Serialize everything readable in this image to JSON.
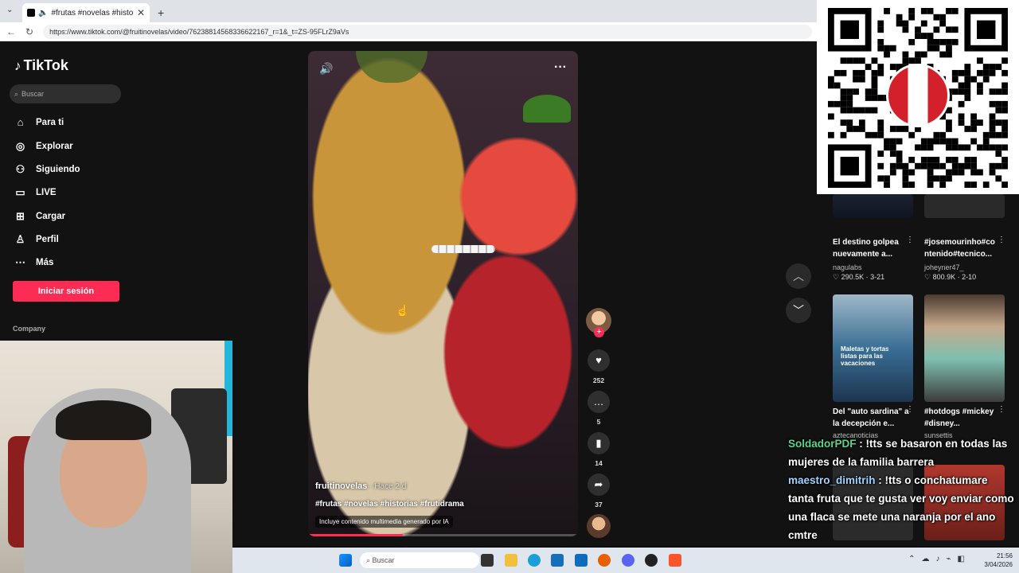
{
  "browser": {
    "tab_title": "#frutas #novelas #historias #",
    "tab_close": "✕",
    "new_tab": "+",
    "url": "https://www.tiktok.com/@fruitinovelas/video/76238814568336622167_r=1&_t=ZS-95FLrZ9aVs"
  },
  "sidebar": {
    "logo": "TikTok",
    "search_placeholder": "Buscar",
    "items": [
      {
        "label": "Para ti",
        "icon": "home-icon"
      },
      {
        "label": "Explorar",
        "icon": "compass-icon"
      },
      {
        "label": "Siguiendo",
        "icon": "following-icon"
      },
      {
        "label": "LIVE",
        "icon": "live-icon"
      },
      {
        "label": "Cargar",
        "icon": "upload-icon"
      },
      {
        "label": "Perfil",
        "icon": "profile-icon"
      },
      {
        "label": "Más",
        "icon": "more-dots-icon"
      }
    ],
    "login_label": "Iniciar sesión",
    "company_label": "Company"
  },
  "video": {
    "author": "fruitinovelas",
    "time": " · Hace 2 d",
    "caption": "#frutas #novelas #historias #frutidrama",
    "ai_badge": "Incluye contenido multimedia generado por IA",
    "progress": 0.35
  },
  "actions": {
    "likes": "252",
    "comments": "5",
    "saves": "14",
    "shares": "37"
  },
  "related": [
    {
      "title": "El destino golpea nuevamente a...",
      "author": "nagulabs",
      "stats": "♡ 290.5K · 3-21"
    },
    {
      "title": "#josemourinho#co ntenido#tecnico...",
      "author": "joheyner47_",
      "stats": "♡ 800.9K · 2-10"
    },
    {
      "title": "Del \"auto sardina\" a la decepción e...",
      "author": "aztecanoticias",
      "stats": "",
      "thumb_text": "Maletas y tortas listas para las vacaciones"
    },
    {
      "title": "#hotdogs #mickey #disney...",
      "author": "sunsettis",
      "stats": ""
    }
  ],
  "chat": [
    {
      "user": "SoldadorPDF",
      "text": " : !tts se basaron en todas las mujeres de la familia barrera"
    },
    {
      "user": "maestro_dimitrih",
      "text": " : !tts o conchatumare tanta fruta que te gusta ver voy enviar como una flaca se mete una naranja por el ano cmtre"
    }
  ],
  "taskbar": {
    "search_placeholder": "Buscar",
    "time": "21:56",
    "date": "3/04/2026"
  }
}
